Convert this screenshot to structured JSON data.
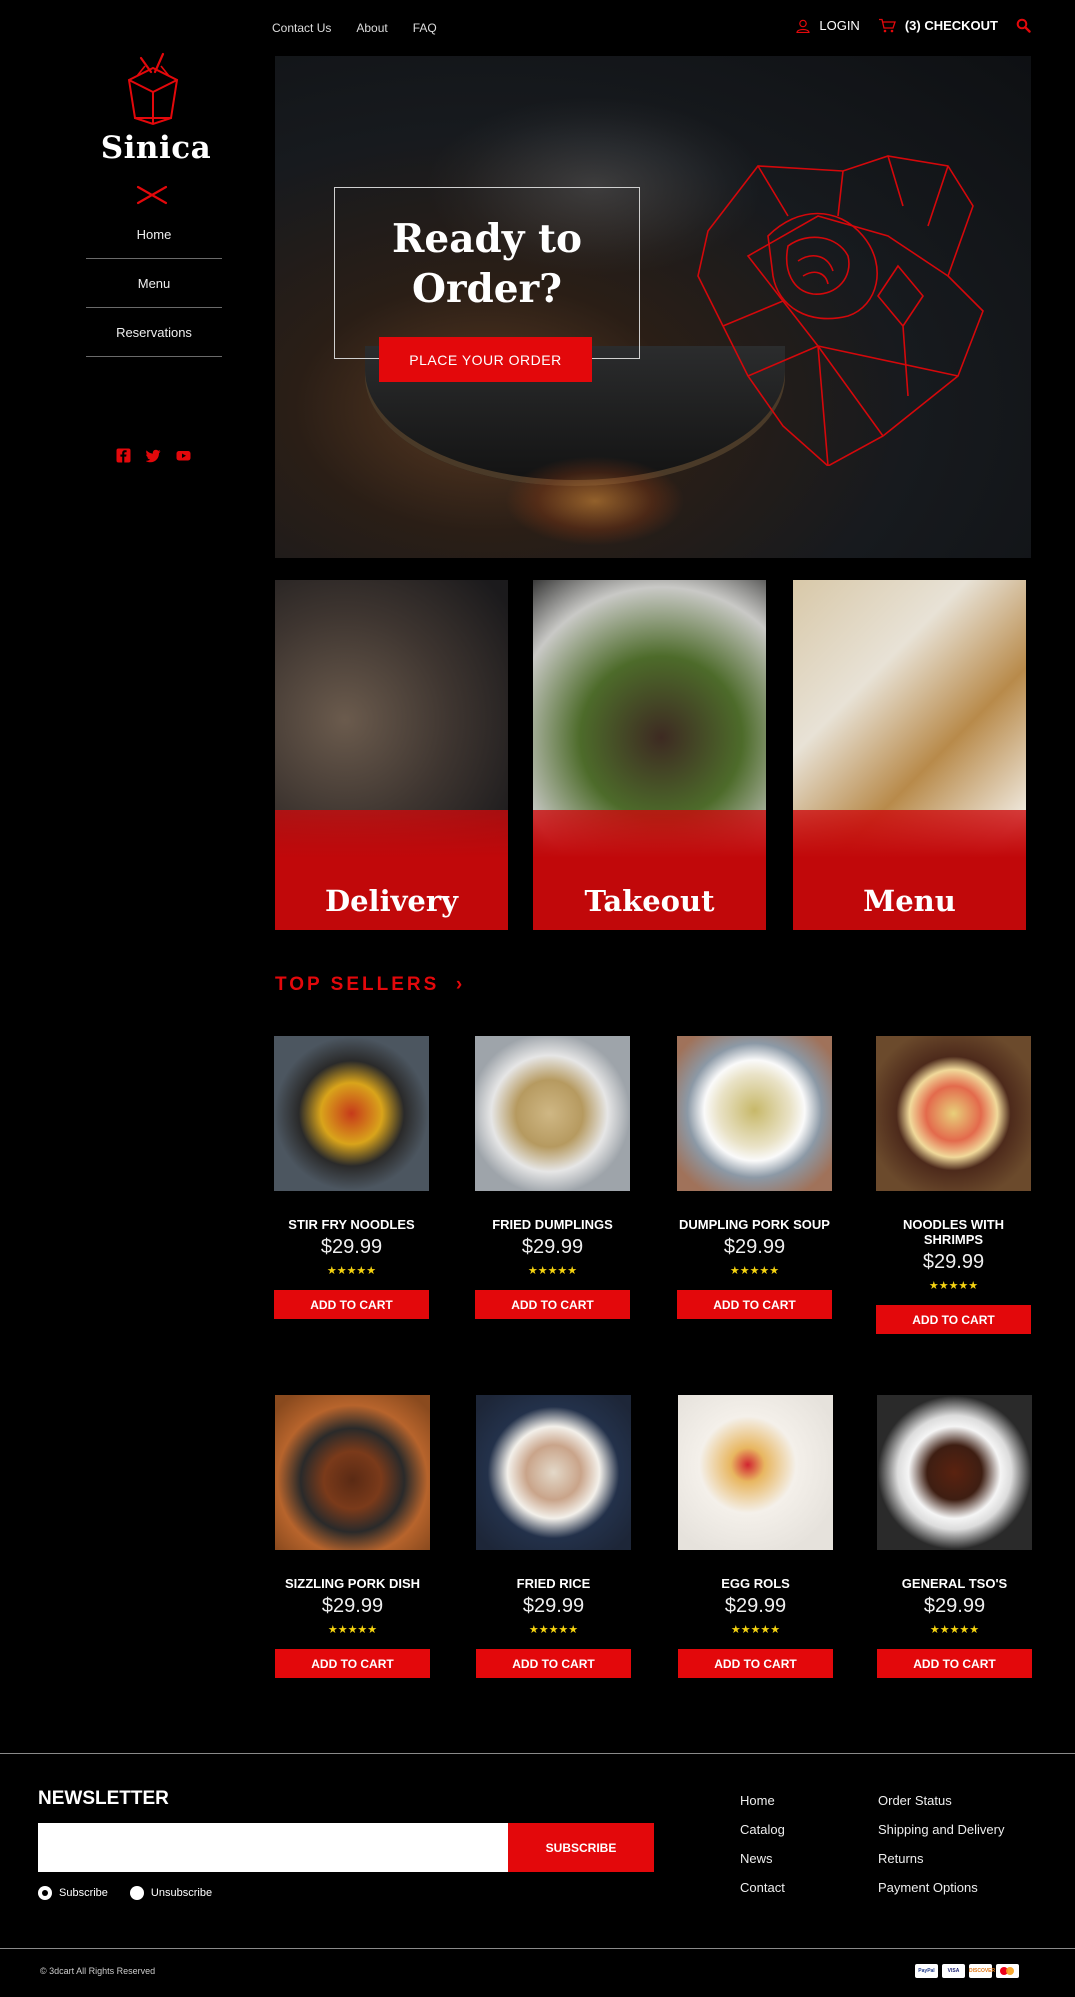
{
  "top_nav": {
    "links": [
      "Contact Us",
      "About",
      "FAQ"
    ],
    "login_label": "LOGIN",
    "checkout_label": "(3) CHECKOUT",
    "icons": [
      "user-icon",
      "cart-icon",
      "search-icon"
    ]
  },
  "sidebar": {
    "brand": "Sinica",
    "nav": [
      "Home",
      "Menu",
      "Reservations"
    ],
    "socials": [
      "facebook-icon",
      "twitter-icon",
      "youtube-icon"
    ]
  },
  "hero": {
    "title": "Ready to Order?",
    "cta": "PLACE YOUR ORDER"
  },
  "categories": [
    "Delivery",
    "Takeout",
    "Menu"
  ],
  "top_sellers": {
    "title": "TOP SELLERS",
    "rating": "★★★★★",
    "add_label": "ADD TO CART",
    "products": [
      {
        "name": "STIR FRY NOODLES",
        "price": "$29.99"
      },
      {
        "name": "FRIED DUMPLINGS",
        "price": "$29.99"
      },
      {
        "name": "DUMPLING PORK SOUP",
        "price": "$29.99"
      },
      {
        "name": "NOODLES WITH SHRIMPS",
        "price": "$29.99"
      },
      {
        "name": "SIZZLING PORK DISH",
        "price": "$29.99"
      },
      {
        "name": "FRIED RICE",
        "price": "$29.99"
      },
      {
        "name": "EGG ROLS",
        "price": "$29.99"
      },
      {
        "name": "GENERAL TSO'S",
        "price": "$29.99"
      }
    ]
  },
  "newsletter": {
    "title": "NEWSLETTER",
    "input_value": "",
    "button": "SUBSCRIBE",
    "options": [
      "Subscribe",
      "Unsubscribe"
    ],
    "selected": "Subscribe"
  },
  "footer": {
    "col1": [
      "Home",
      "Catalog",
      "News",
      "Contact"
    ],
    "col2": [
      "Order Status",
      "Shipping and Delivery",
      "Returns",
      "Payment Options"
    ],
    "copyright": "© 3dcart All Rights Reserved",
    "payments": [
      "PayPal",
      "VISA",
      "DISCOVER",
      "mastercard"
    ]
  },
  "colors": {
    "accent": "#e3080b",
    "background": "#000000",
    "stars": "#f4d210"
  }
}
